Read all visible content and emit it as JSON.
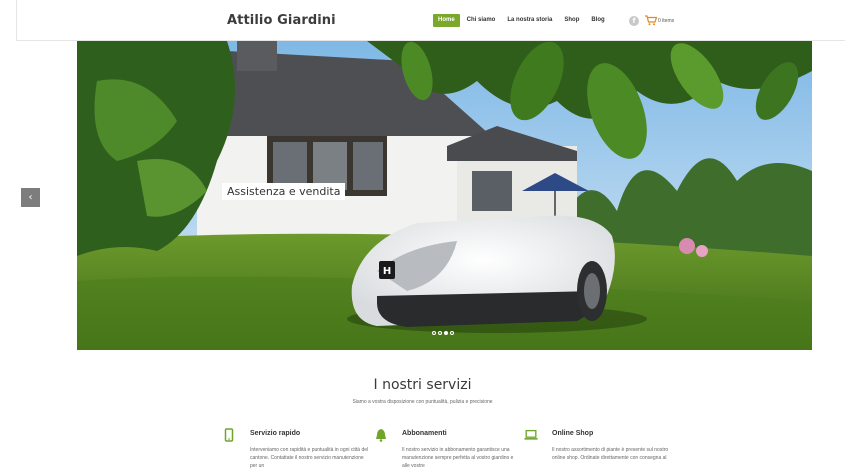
{
  "header": {
    "brand": "Attilio Giardini",
    "nav": [
      "Home",
      "Chi siamo",
      "La nostra storia",
      "Shop",
      "Blog"
    ],
    "cart_label": "0 items",
    "colors": {
      "accent": "#7aa82b"
    }
  },
  "slider": {
    "caption": "Assistenza e vendita",
    "prev_label": "‹",
    "slide_count": 4,
    "active_slide": 3
  },
  "services": {
    "title": "I nostri servizi",
    "subtitle": "Siamo a vostra disposizione con puntualità, pulizia e precisione",
    "items": [
      {
        "icon": "mobile-phone-icon",
        "title": "Servizio rapido",
        "text": "Interveniamo con rapidità e puntualità in ogni città del cantone. Contattate il nostro servizio manutenzione per un"
      },
      {
        "icon": "bell-icon",
        "title": "Abbonamenti",
        "text": "Il nostro servizio in abbonamento garantisce una manutenzione sempre perfetta al vostro giardino e alle vostre"
      },
      {
        "icon": "laptop-icon",
        "title": "Online Shop",
        "text": "Il nostro assortimento di piante è presente sul nostro online shop. Ordinate direttamente con consegna al"
      }
    ]
  }
}
